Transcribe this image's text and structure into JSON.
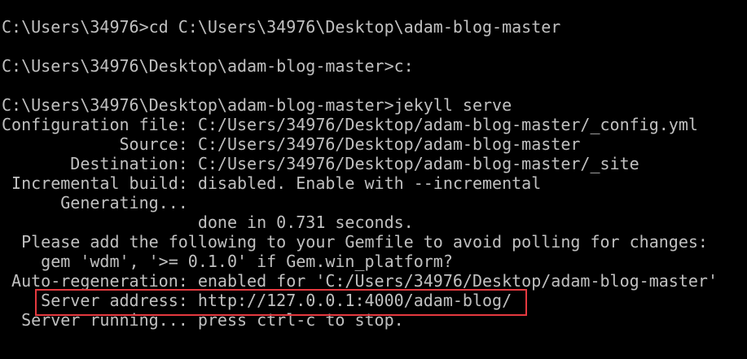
{
  "terminal": {
    "background": "#000000",
    "text_color": "#c0c0c0",
    "highlight_color": "#e5393f",
    "lines": [
      "C:\\Users\\34976>cd C:\\Users\\34976\\Desktop\\adam-blog-master",
      "",
      "C:\\Users\\34976\\Desktop\\adam-blog-master>c:",
      "",
      "C:\\Users\\34976\\Desktop\\adam-blog-master>jekyll serve",
      "Configuration file: C:/Users/34976/Desktop/adam-blog-master/_config.yml",
      "            Source: C:/Users/34976/Desktop/adam-blog-master",
      "       Destination: C:/Users/34976/Desktop/adam-blog-master/_site",
      " Incremental build: disabled. Enable with --incremental",
      "      Generating...",
      "                    done in 0.731 seconds.",
      "  Please add the following to your Gemfile to avoid polling for changes:",
      "    gem 'wdm', '>= 0.1.0' if Gem.win_platform?",
      " Auto-regeneration: enabled for 'C:/Users/34976/Desktop/adam-blog-master'",
      "    Server address: http://127.0.0.1:4000/adam-blog/",
      "  Server running... press ctrl-c to stop."
    ]
  }
}
